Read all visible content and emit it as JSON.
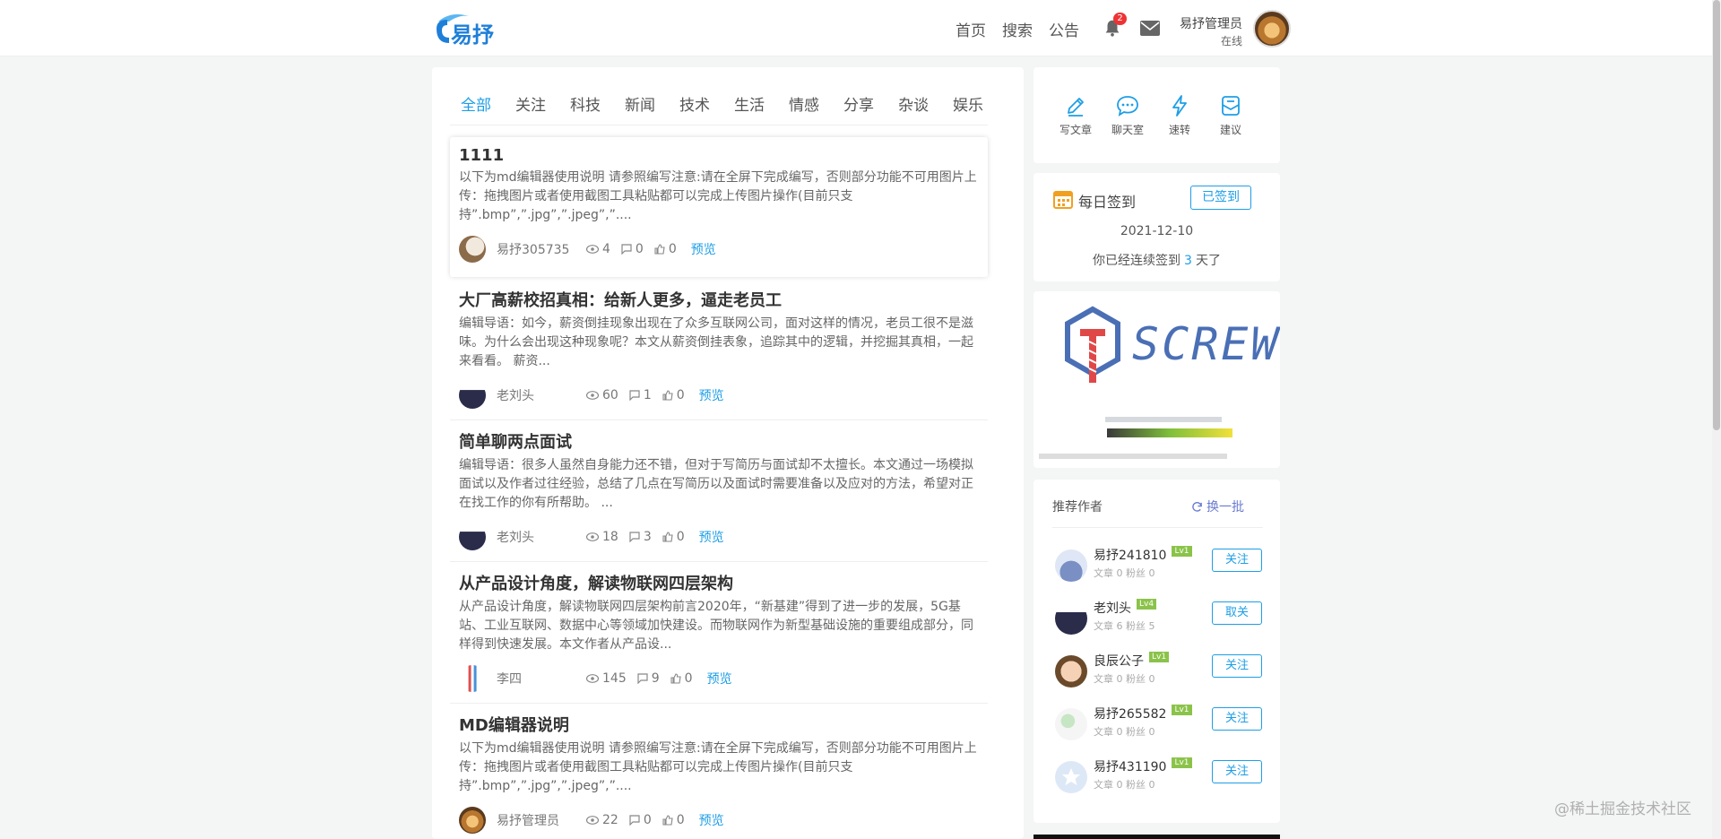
{
  "header": {
    "nav": [
      "首页",
      "搜索",
      "公告"
    ],
    "notification_count": "2",
    "admin_name": "易抒管理员",
    "admin_status": "在线",
    "icons": [
      "bell-icon",
      "mail-icon"
    ]
  },
  "tabs": [
    "全部",
    "关注",
    "科技",
    "新闻",
    "技术",
    "生活",
    "情感",
    "分享",
    "杂谈",
    "娱乐"
  ],
  "articles": [
    {
      "title": "1111",
      "summary": "以下为md编辑器使用说明 请参照编写注意:请在全屏下完成编写，否则部分功能不可用图片上传：拖拽图片或者使用截图工具粘贴都可以完成上传图片操作(目前只支持”.bmp”,”.jpg”,”.jpeg”,”....",
      "author": "易抒305735",
      "views": "4",
      "comments": "0",
      "likes": "0",
      "preview": "预览"
    },
    {
      "title": "大厂高薪校招真相：给新人更多，逼走老员工",
      "summary": "编辑导语：如今，薪资倒挂现象出现在了众多互联网公司，面对这样的情况，老员工很不是滋味。为什么会出现这种现象呢？本文从薪资倒挂表象，追踪其中的逻辑，并挖掘其真相，一起来看看。 薪资...",
      "author": "老刘头",
      "views": "60",
      "comments": "1",
      "likes": "0",
      "preview": "预览"
    },
    {
      "title": "简单聊两点面试",
      "summary": "编辑导语：很多人虽然自身能力还不错，但对于写简历与面试却不太擅长。本文通过一场模拟面试以及作者过往经验，总结了几点在写简历以及面试时需要准备以及应对的方法，希望对正在找工作的你有所帮助。 ...",
      "author": "老刘头",
      "views": "18",
      "comments": "3",
      "likes": "0",
      "preview": "预览"
    },
    {
      "title": "从产品设计角度，解读物联网四层架构",
      "summary": "从产品设计角度，解读物联网四层架构前言2020年，“新基建”得到了进一步的发展，5G基站、工业互联网、数据中心等领域加快建设。而物联网作为新型基础设施的重要组成部分，同样得到快速发展。本文作者从产品设...",
      "author": "李四",
      "views": "145",
      "comments": "9",
      "likes": "0",
      "preview": "预览"
    },
    {
      "title": "MD编辑器说明",
      "summary": "以下为md编辑器使用说明 请参照编写注意:请在全屏下完成编写，否则部分功能不可用图片上传：拖拽图片或者使用截图工具粘贴都可以完成上传图片操作(目前只支持”.bmp”,”.jpg”,”.jpeg”,”....",
      "author": "易抒管理员",
      "views": "22",
      "comments": "0",
      "likes": "0",
      "preview": "预览"
    }
  ],
  "quick_actions": [
    "写文章",
    "聊天室",
    "速转",
    "建议"
  ],
  "signin": {
    "label": "每日签到",
    "button": "已签到",
    "date": "2021-12-10",
    "days_prefix": "你已经连续签到",
    "days": "3",
    "days_suffix": "天了"
  },
  "banner": {
    "text": "SCREW"
  },
  "recommend": {
    "title": "推荐作者",
    "refresh": "换一批",
    "authors": [
      {
        "name": "易抒241810",
        "level": "Lv1",
        "stats": "文章 0 粉丝 0",
        "action": "关注"
      },
      {
        "name": "老刘头",
        "level": "Lv4",
        "stats": "文章 6 粉丝 5",
        "action": "取关"
      },
      {
        "name": "良辰公子",
        "level": "Lv1",
        "stats": "文章 0 粉丝 0",
        "action": "关注"
      },
      {
        "name": "易抒265582",
        "level": "Lv1",
        "stats": "文章 0 粉丝 0",
        "action": "关注"
      },
      {
        "name": "易抒431190",
        "level": "Lv1",
        "stats": "文章 0 粉丝 0",
        "action": "关注"
      }
    ]
  },
  "watermark": "@稀土掘金技术社区",
  "colors": {
    "accent": "#1d9ee6",
    "background": "#f4f5f5",
    "level_badge": "#8bc34a",
    "notification": "#e33333"
  }
}
